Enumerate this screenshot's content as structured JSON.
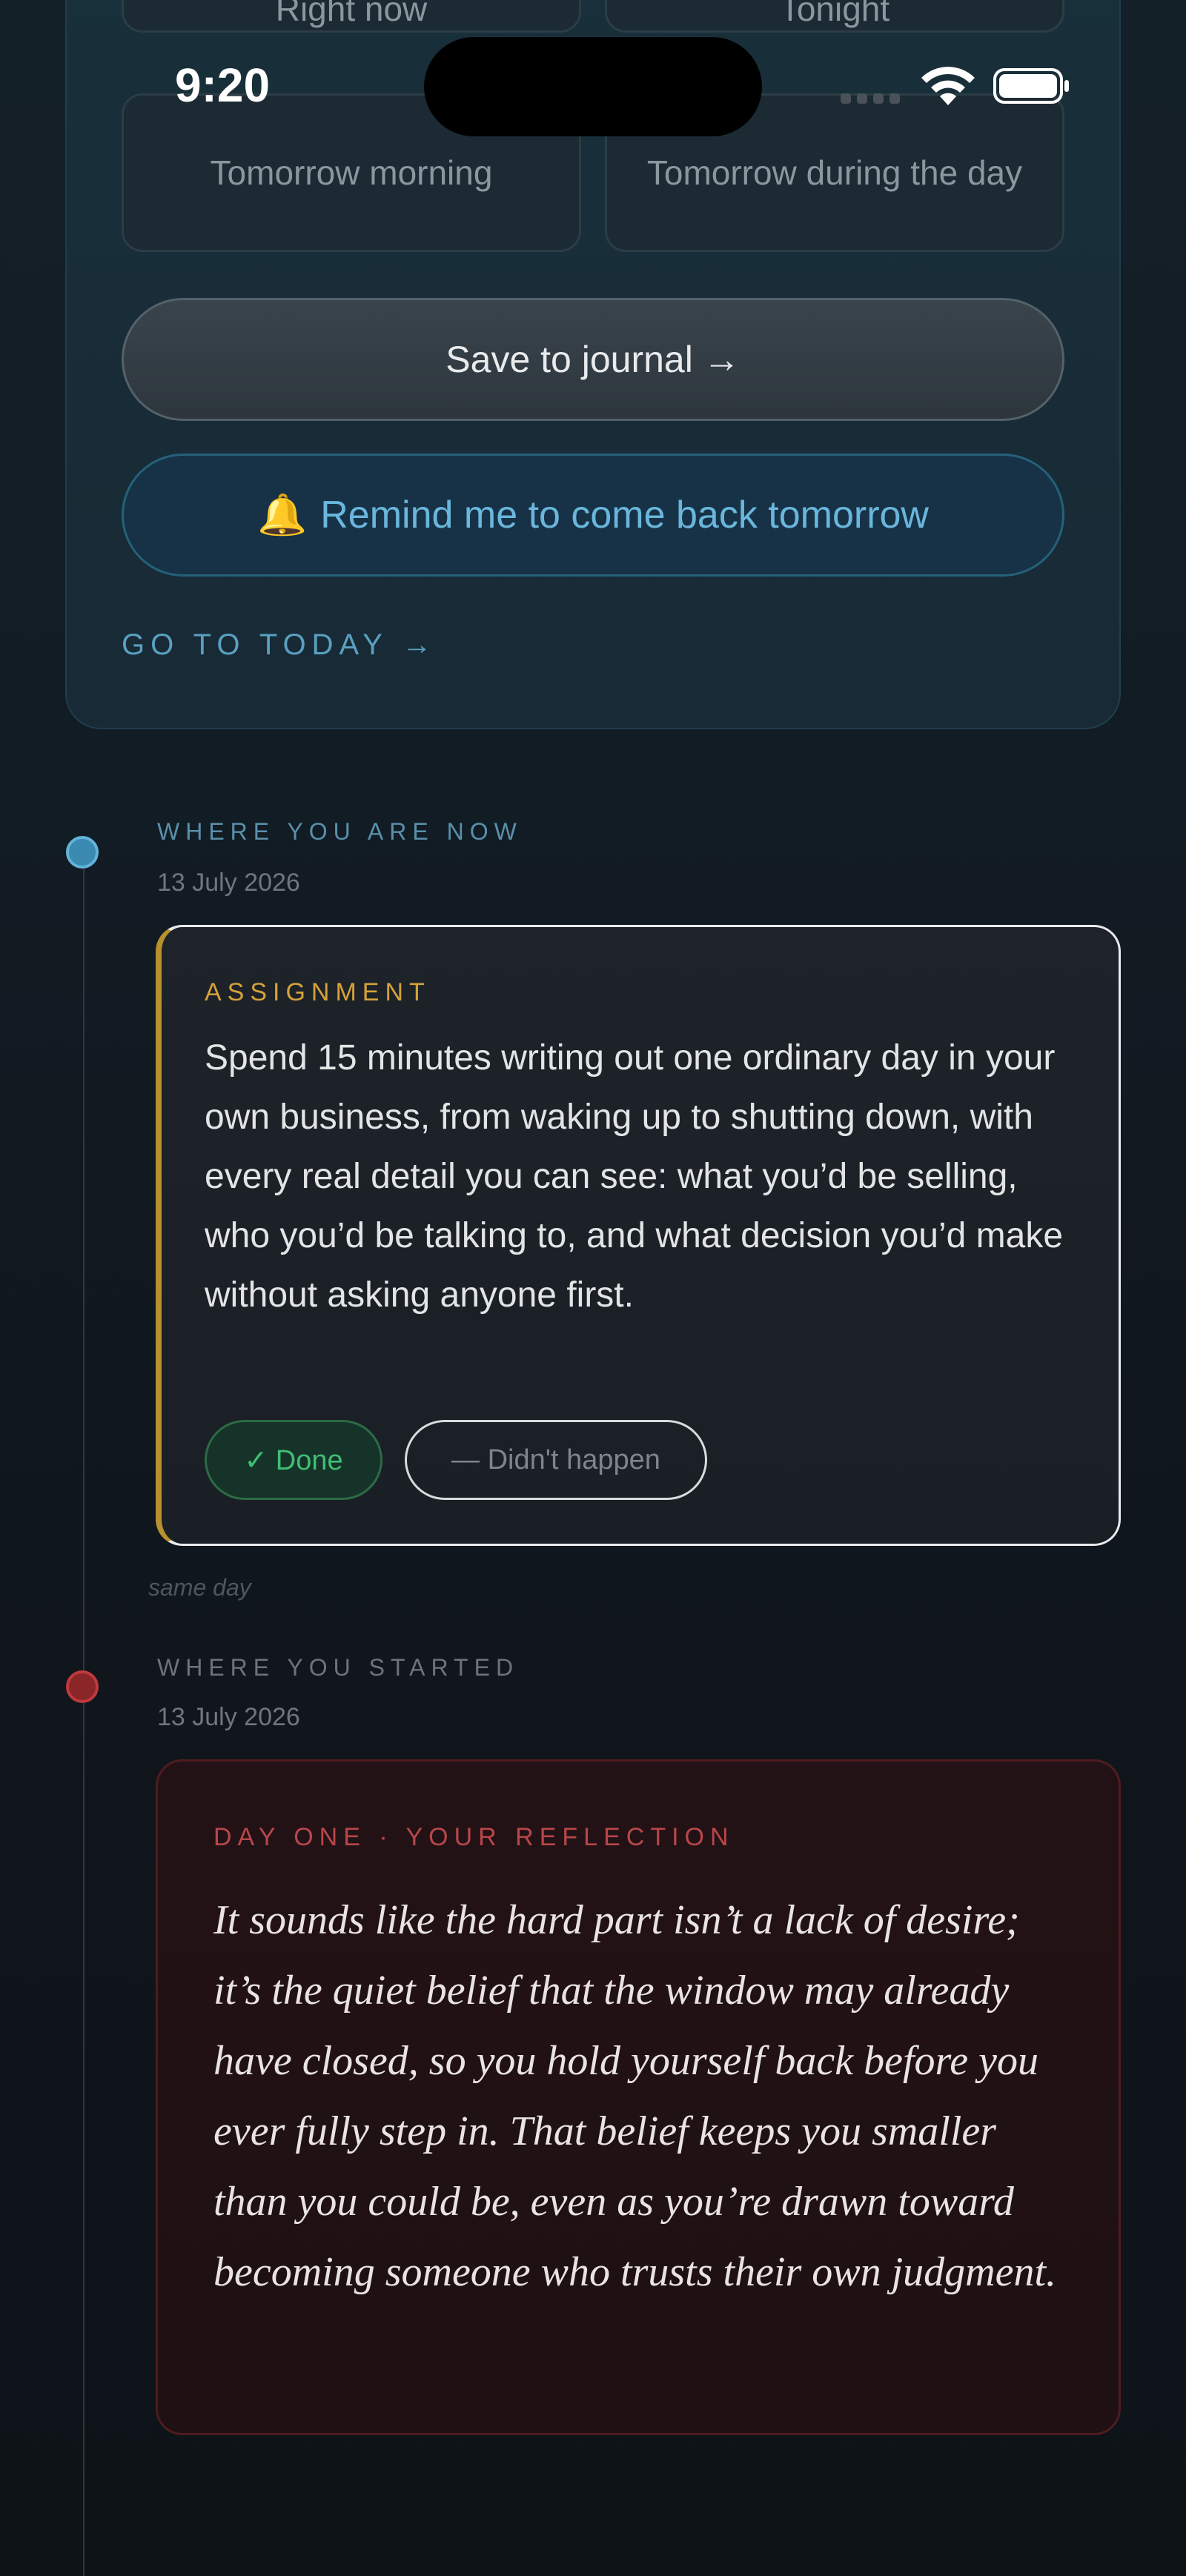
{
  "status_bar": {
    "time": "9:20"
  },
  "timing_options": [
    "Right now",
    "Tonight",
    "Tomorrow morning",
    "Tomorrow during the day"
  ],
  "actions": {
    "save": "Save to journal →",
    "remind": "Remind me to come back tomorrow",
    "goto_today": "GO TO TODAY →"
  },
  "timeline": {
    "now": {
      "label": "WHERE YOU ARE NOW",
      "date": "13 July 2026",
      "card_label": "ASSIGNMENT",
      "card_text": "Spend 15 minutes writing out one ordinary day in your own business, from waking up to shutting down, with every real detail you can see: what you’d be selling, who you’d be talking to, and what decision you’d make without asking anyone first.",
      "done_label": "✓ Done",
      "not_label": "— Didn't happen"
    },
    "gap_label": "same day",
    "start": {
      "label": "WHERE YOU STARTED",
      "date": "13 July 2026",
      "card_label": "DAY ONE · YOUR REFLECTION",
      "card_text": "It sounds like the hard part isn’t a lack of desire; it’s the quiet belief that the window may already have closed, so you hold yourself back before you ever fully step in. That belief keeps you smaller than you could be, even as you’re drawn toward becoming someone who trusts their own judgment."
    }
  },
  "colors": {
    "accent_blue": "#62b3da",
    "assignment_gold": "#d4a23a",
    "done_green": "#3fbf73",
    "reflection_red": "#b8464a"
  },
  "icons": {
    "bell": "bell-icon",
    "wifi": "wifi-icon",
    "battery": "battery-icon",
    "signal": "cellular-signal-icon"
  }
}
